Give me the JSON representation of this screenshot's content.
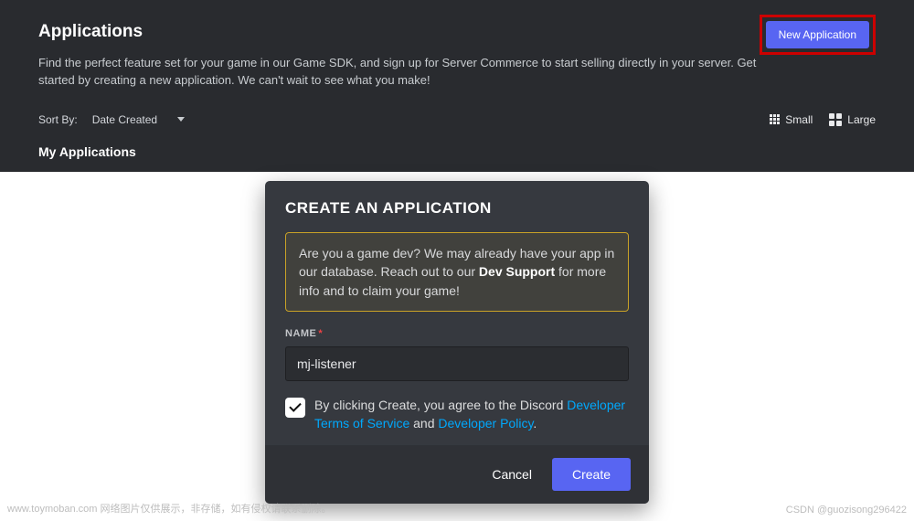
{
  "header": {
    "title": "Applications",
    "new_app_label": "New Application",
    "description": "Find the perfect feature set for your game in our Game SDK, and sign up for Server Commerce to start selling directly in your server. Get started by creating a new application. We can't wait to see what you make!",
    "sort_label": "Sort By:",
    "sort_value": "Date Created",
    "view_small": "Small",
    "view_large": "Large",
    "section_heading": "My Applications"
  },
  "modal": {
    "title": "CREATE AN APPLICATION",
    "info_prefix": "Are you a game dev? We may already have your app in our database. Reach out to our ",
    "info_strong": "Dev Support",
    "info_suffix": " for more info and to claim your game!",
    "name_label": "NAME",
    "name_required": "*",
    "name_value": "mj-listener",
    "agree_prefix": "By clicking Create, you agree to the Discord ",
    "agree_link1": "Developer Terms of Service",
    "agree_mid": " and ",
    "agree_link2": "Developer Policy",
    "agree_suffix": ".",
    "cancel_label": "Cancel",
    "create_label": "Create"
  },
  "watermarks": {
    "left": "www.toymoban.com 网络图片仅供展示，非存储，如有侵权请联系删除。",
    "right": "CSDN @guozisong296422"
  }
}
